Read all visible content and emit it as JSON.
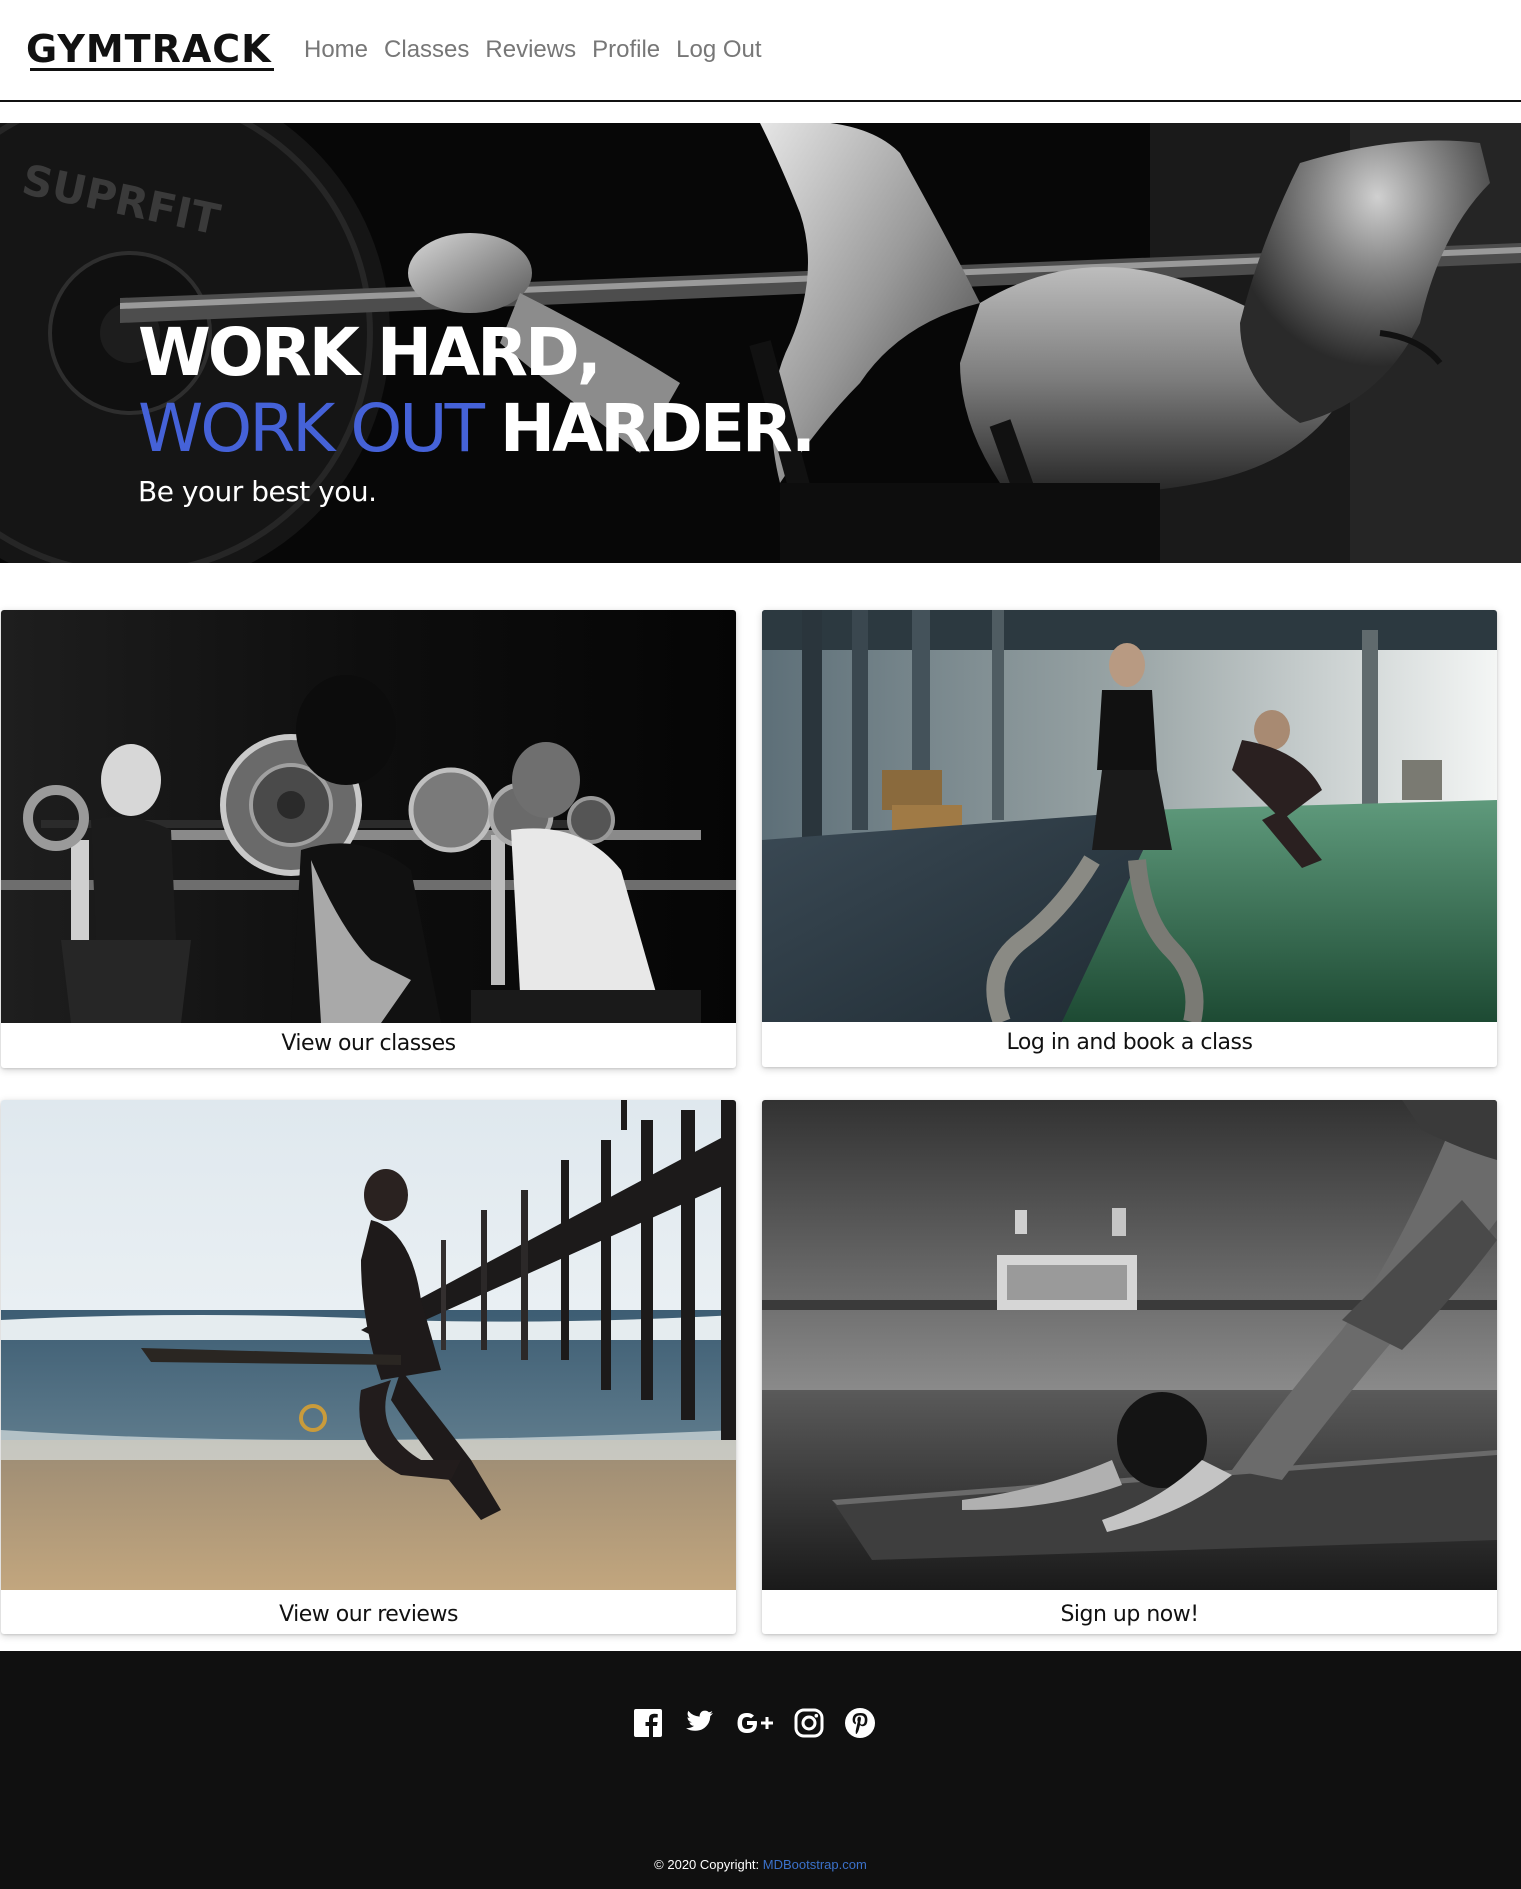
{
  "brand": {
    "logo": "GYMTRACK"
  },
  "nav": {
    "items": [
      {
        "label": "Home"
      },
      {
        "label": "Classes"
      },
      {
        "label": "Reviews"
      },
      {
        "label": "Profile"
      },
      {
        "label": "Log Out"
      }
    ]
  },
  "hero": {
    "line1": "WORK HARD,",
    "line2_accent": "WORK OUT",
    "line2_rest": "HARDER.",
    "subtitle": "Be your best you.",
    "accent_color": "#4562d8",
    "plate_text": "SUPRFIT"
  },
  "cards": [
    {
      "caption": "View our classes",
      "image": "group-barbell-squat-photo"
    },
    {
      "caption": "Log in and book a class",
      "image": "battle-ropes-gym-photo"
    },
    {
      "caption": "View our reviews",
      "image": "beach-runner-pier-photo"
    },
    {
      "caption": "Sign up now!",
      "image": "yoga-downward-dog-photo"
    }
  ],
  "footer": {
    "social_icons": [
      "facebook-icon",
      "twitter-icon",
      "google-plus-icon",
      "instagram-icon",
      "pinterest-icon"
    ],
    "copyright_prefix": "© 2020 Copyright:",
    "copyright_link": "MDBootstrap.com",
    "link_color": "#3b71ca"
  }
}
